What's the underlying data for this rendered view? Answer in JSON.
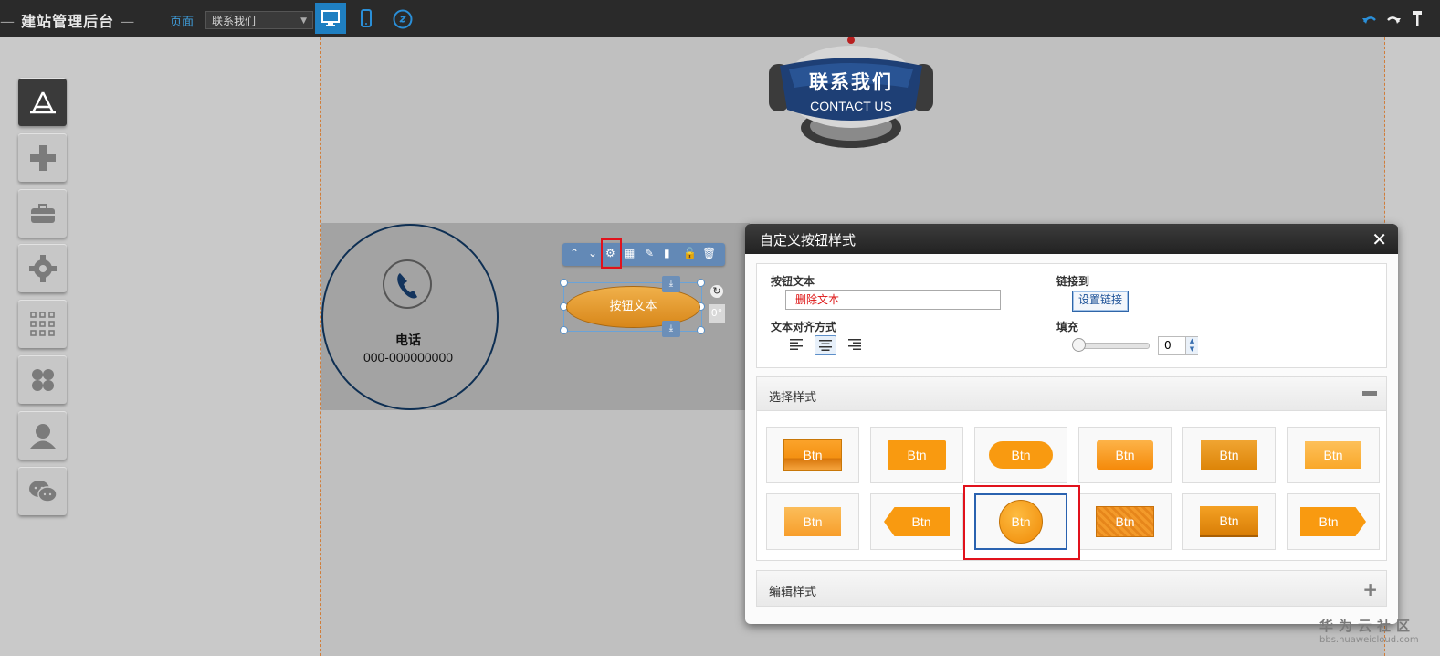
{
  "topbar": {
    "title": "建站管理后台",
    "page_label": "页面",
    "page_select": "联系我们"
  },
  "sidebar_icons": [
    "app-store-icon",
    "add-icon",
    "toolbox-icon",
    "settings-gear-icon",
    "grid-apps-icon",
    "clover-icon",
    "user-icon",
    "wechat-icon"
  ],
  "header_logo": {
    "title": "联系我们",
    "subtitle": "CONTACT US"
  },
  "phone_block": {
    "title": "电话",
    "number": "000-000000000"
  },
  "selected_button": {
    "label": "按钮文本",
    "degree": "0°"
  },
  "dialog": {
    "title": "自定义按钮样式",
    "close": "✕",
    "button_text_label": "按钮文本",
    "button_text_value": "删除文本",
    "link_label": "链接到",
    "link_button": "设置链接",
    "align_label": "文本对齐方式",
    "padding_label": "填充",
    "padding_value": "0",
    "choose_style_title": "选择样式",
    "edit_style_title": "编辑样式",
    "style_label": "Btn"
  },
  "watermark": {
    "brand": "华为云社区",
    "url": "bbs.huaweicloud.com"
  },
  "colors": {
    "accent_blue": "#1f7fc1",
    "orange": "#f39a16",
    "highlight_red": "#e1121c"
  }
}
